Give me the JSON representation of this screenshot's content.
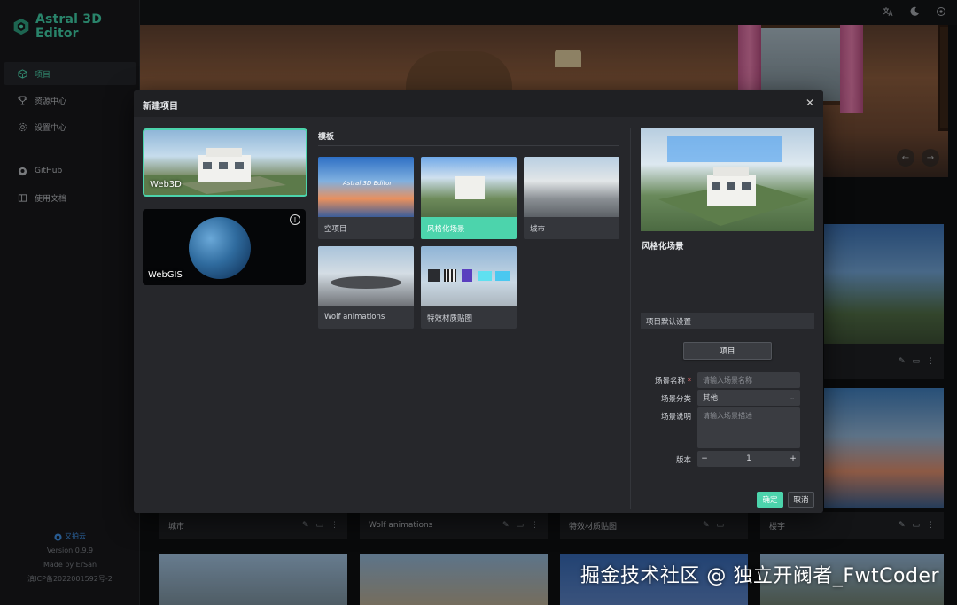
{
  "app": {
    "title": "Astral 3D Editor"
  },
  "sidebar": {
    "items": [
      {
        "label": "项目",
        "icon": "cube-icon",
        "active": true
      },
      {
        "label": "资源中心",
        "icon": "trophy-icon"
      },
      {
        "label": "设置中心",
        "icon": "gear-icon"
      }
    ],
    "links": [
      {
        "label": "GitHub",
        "icon": "github-icon"
      },
      {
        "label": "使用文档",
        "icon": "book-icon"
      }
    ],
    "footer": {
      "cloud": "又拍云",
      "version": "Version 0.9.9",
      "made_by": "Made by ErSan",
      "icp": "滇ICP备2022001592号-2"
    }
  },
  "topbar": {
    "icons": [
      "language-icon",
      "moon-icon",
      "settings-icon"
    ]
  },
  "background_cards": [
    {
      "title": "城市"
    },
    {
      "title": "Wolf animations"
    },
    {
      "title": "特效材质贴图"
    },
    {
      "title": "楼宇"
    }
  ],
  "modal": {
    "title": "新建项目",
    "project_types": [
      {
        "label": "Web3D",
        "selected": true
      },
      {
        "label": "WebGIS",
        "selected": false
      }
    ],
    "templates_title": "模板",
    "templates": [
      {
        "label": "空项目",
        "thumb_text": "Astral 3D Editor"
      },
      {
        "label": "风格化场景",
        "selected": true
      },
      {
        "label": "城市"
      },
      {
        "label": "Wolf animations"
      },
      {
        "label": "特效材质贴图"
      }
    ],
    "preview_name": "风格化场景",
    "section_title": "项目默认设置",
    "tab_label": "项目",
    "form": {
      "scene_name_label": "场景名称",
      "scene_name_placeholder": "请输入场景名称",
      "category_label": "场景分类",
      "category_value": "其他",
      "desc_label": "场景说明",
      "desc_placeholder": "请输入场景描述",
      "version_label": "版本",
      "version_value": "1"
    },
    "ok_label": "确定",
    "cancel_label": "取消"
  },
  "watermark": "掘金技术社区 @ 独立开阀者_FwtCoder",
  "colors": {
    "accent": "#4cd4ac",
    "bg": "#0f1012",
    "panel": "#26272b"
  }
}
